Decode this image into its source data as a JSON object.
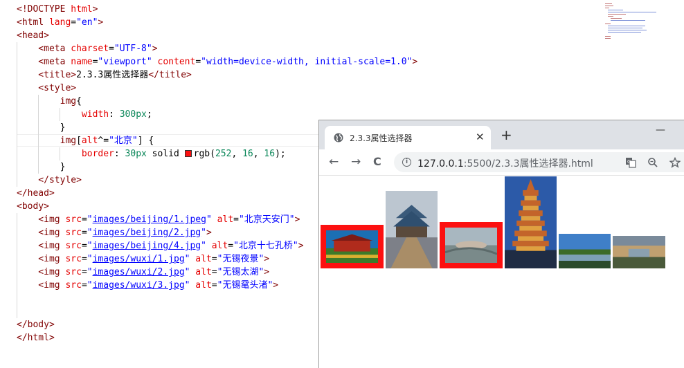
{
  "editor": {
    "lines": [
      [
        {
          "t": "<!DOCTYPE ",
          "c": "tag"
        },
        {
          "t": "html",
          "c": "attr"
        },
        {
          "t": ">",
          "c": "tag"
        }
      ],
      [
        {
          "t": "<html ",
          "c": "tag"
        },
        {
          "t": "lang",
          "c": "attr"
        },
        {
          "t": "=",
          "c": "txt"
        },
        {
          "t": "\"en\"",
          "c": "str"
        },
        {
          "t": ">",
          "c": "tag"
        }
      ],
      [
        {
          "t": "<head>",
          "c": "tag"
        }
      ],
      [
        {
          "t": "    <meta ",
          "c": "tag"
        },
        {
          "t": "charset",
          "c": "attr"
        },
        {
          "t": "=",
          "c": "txt"
        },
        {
          "t": "\"UTF-8\"",
          "c": "str"
        },
        {
          "t": ">",
          "c": "tag"
        }
      ],
      [
        {
          "t": "    <meta ",
          "c": "tag"
        },
        {
          "t": "name",
          "c": "attr"
        },
        {
          "t": "=",
          "c": "txt"
        },
        {
          "t": "\"viewport\"",
          "c": "str"
        },
        {
          "t": " content",
          "c": "attr"
        },
        {
          "t": "=",
          "c": "txt"
        },
        {
          "t": "\"width=device-width, initial-scale=1.0\"",
          "c": "str"
        },
        {
          "t": ">",
          "c": "tag"
        }
      ],
      [
        {
          "t": "    <title>",
          "c": "tag"
        },
        {
          "t": "2.3.3属性选择器",
          "c": "txt"
        },
        {
          "t": "</title>",
          "c": "tag"
        }
      ],
      [
        {
          "t": "    <style>",
          "c": "tag"
        }
      ],
      [
        {
          "t": "        img",
          "c": "tag"
        },
        {
          "t": "{",
          "c": "txt"
        }
      ],
      [
        {
          "t": "            width",
          "c": "prop"
        },
        {
          "t": ": ",
          "c": "txt"
        },
        {
          "t": "300px",
          "c": "num"
        },
        {
          "t": ";",
          "c": "txt"
        }
      ],
      [
        {
          "t": "        }",
          "c": "txt"
        }
      ],
      [
        {
          "t": "        img",
          "c": "tag"
        },
        {
          "t": "[",
          "c": "txt"
        },
        {
          "t": "alt",
          "c": "attr"
        },
        {
          "t": "^=",
          "c": "txt"
        },
        {
          "t": "\"北京\"",
          "c": "str"
        },
        {
          "t": "] {",
          "c": "txt"
        }
      ],
      [
        {
          "t": "            border",
          "c": "prop"
        },
        {
          "t": ": ",
          "c": "txt"
        },
        {
          "t": "30px",
          "c": "num"
        },
        {
          "t": " solid ",
          "c": "txt"
        },
        {
          "t": "SWATCH",
          "c": "swatch"
        },
        {
          "t": "rgb(",
          "c": "txt"
        },
        {
          "t": "252",
          "c": "num"
        },
        {
          "t": ", ",
          "c": "txt"
        },
        {
          "t": "16",
          "c": "num"
        },
        {
          "t": ", ",
          "c": "txt"
        },
        {
          "t": "16",
          "c": "num"
        },
        {
          "t": ");",
          "c": "txt"
        }
      ],
      [
        {
          "t": "        }",
          "c": "txt"
        }
      ],
      [
        {
          "t": "    </style>",
          "c": "tag"
        }
      ],
      [
        {
          "t": "</head>",
          "c": "tag"
        }
      ],
      [
        {
          "t": "<body>",
          "c": "tag"
        }
      ],
      [
        {
          "t": "    <img ",
          "c": "tag"
        },
        {
          "t": "src",
          "c": "attr"
        },
        {
          "t": "=",
          "c": "txt"
        },
        {
          "t": "\"",
          "c": "str"
        },
        {
          "t": "images/beijing/1.jpeg",
          "c": "link"
        },
        {
          "t": "\"",
          "c": "str"
        },
        {
          "t": " alt",
          "c": "attr"
        },
        {
          "t": "=",
          "c": "txt"
        },
        {
          "t": "\"北京天安门\"",
          "c": "str"
        },
        {
          "t": ">",
          "c": "tag"
        }
      ],
      [
        {
          "t": "    <img ",
          "c": "tag"
        },
        {
          "t": "src",
          "c": "attr"
        },
        {
          "t": "=",
          "c": "txt"
        },
        {
          "t": "\"",
          "c": "str"
        },
        {
          "t": "images/beijing/2.jpg",
          "c": "link"
        },
        {
          "t": "\"",
          "c": "str"
        },
        {
          "t": ">",
          "c": "tag"
        }
      ],
      [
        {
          "t": "    <img ",
          "c": "tag"
        },
        {
          "t": "src",
          "c": "attr"
        },
        {
          "t": "=",
          "c": "txt"
        },
        {
          "t": "\"",
          "c": "str"
        },
        {
          "t": "images/beijing/4.jpg",
          "c": "link"
        },
        {
          "t": "\"",
          "c": "str"
        },
        {
          "t": " alt",
          "c": "attr"
        },
        {
          "t": "=",
          "c": "txt"
        },
        {
          "t": "\"北京十七孔桥\"",
          "c": "str"
        },
        {
          "t": ">",
          "c": "tag"
        }
      ],
      [
        {
          "t": "    <img ",
          "c": "tag"
        },
        {
          "t": "src",
          "c": "attr"
        },
        {
          "t": "=",
          "c": "txt"
        },
        {
          "t": "\"",
          "c": "str"
        },
        {
          "t": "images/wuxi/1.jpg",
          "c": "link"
        },
        {
          "t": "\"",
          "c": "str"
        },
        {
          "t": " alt",
          "c": "attr"
        },
        {
          "t": "=",
          "c": "txt"
        },
        {
          "t": "\"无锡夜景\"",
          "c": "str"
        },
        {
          "t": ">",
          "c": "tag"
        }
      ],
      [
        {
          "t": "    <img ",
          "c": "tag"
        },
        {
          "t": "src",
          "c": "attr"
        },
        {
          "t": "=",
          "c": "txt"
        },
        {
          "t": "\"",
          "c": "str"
        },
        {
          "t": "images/wuxi/2.jpg",
          "c": "link"
        },
        {
          "t": "\"",
          "c": "str"
        },
        {
          "t": " alt",
          "c": "attr"
        },
        {
          "t": "=",
          "c": "txt"
        },
        {
          "t": "\"无锡太湖\"",
          "c": "str"
        },
        {
          "t": ">",
          "c": "tag"
        }
      ],
      [
        {
          "t": "    <img ",
          "c": "tag"
        },
        {
          "t": "src",
          "c": "attr"
        },
        {
          "t": "=",
          "c": "txt"
        },
        {
          "t": "\"",
          "c": "str"
        },
        {
          "t": "images/wuxi/3.jpg",
          "c": "link"
        },
        {
          "t": "\"",
          "c": "str"
        },
        {
          "t": " alt",
          "c": "attr"
        },
        {
          "t": "=",
          "c": "txt"
        },
        {
          "t": "\"无锡鼋头渚\"",
          "c": "str"
        },
        {
          "t": ">",
          "c": "tag"
        }
      ],
      [],
      [],
      [
        {
          "t": "</body>",
          "c": "tag"
        }
      ],
      [
        {
          "t": "</html>",
          "c": "tag"
        }
      ]
    ]
  },
  "browser": {
    "tab_title": "2.3.3属性选择器",
    "tab_close": "✕",
    "new_tab": "+",
    "minimize": "—",
    "back": "←",
    "forward": "→",
    "reload": "C",
    "info": "i",
    "url_host": "127.0.0.1",
    "url_path": ":5500/2.3.3属性选择器.html",
    "translate_icon": "translate-icon",
    "zoom_icon": "magnifier-icon",
    "bookmark_icon": "star-icon",
    "images": [
      {
        "name": "北京天安门",
        "alt": "北京天安门",
        "bordered": true,
        "palette": [
          "#1b6fb3",
          "#b02b1c",
          "#7c1b16",
          "#3d7a2a"
        ]
      },
      {
        "name": "beijing-2",
        "alt": "",
        "bordered": false,
        "palette": [
          "#bcc6d0",
          "#5a4a3c",
          "#7d8088",
          "#a98d67"
        ]
      },
      {
        "name": "北京十七孔桥",
        "alt": "北京十七孔桥",
        "bordered": true,
        "palette": [
          "#a8b7c0",
          "#7a8a8a",
          "#c6b8a8",
          "#5c6a6a"
        ]
      },
      {
        "name": "无锡夜景",
        "alt": "无锡夜景",
        "bordered": false,
        "palette": [
          "#2c5aa8",
          "#c3642a",
          "#1f2c44",
          "#e0a040"
        ]
      },
      {
        "name": "无锡太湖",
        "alt": "无锡太湖",
        "bordered": false,
        "palette": [
          "#3f7fc8",
          "#3c6b2a",
          "#7da0b8",
          "#2a4a2a"
        ]
      },
      {
        "name": "无锡鼋头渚",
        "alt": "无锡鼋头渚",
        "bordered": false,
        "palette": [
          "#7a8a9a",
          "#c0a070",
          "#4a5a3a",
          "#8aa0b0"
        ]
      }
    ],
    "accent_border_color": "#fc1010"
  }
}
